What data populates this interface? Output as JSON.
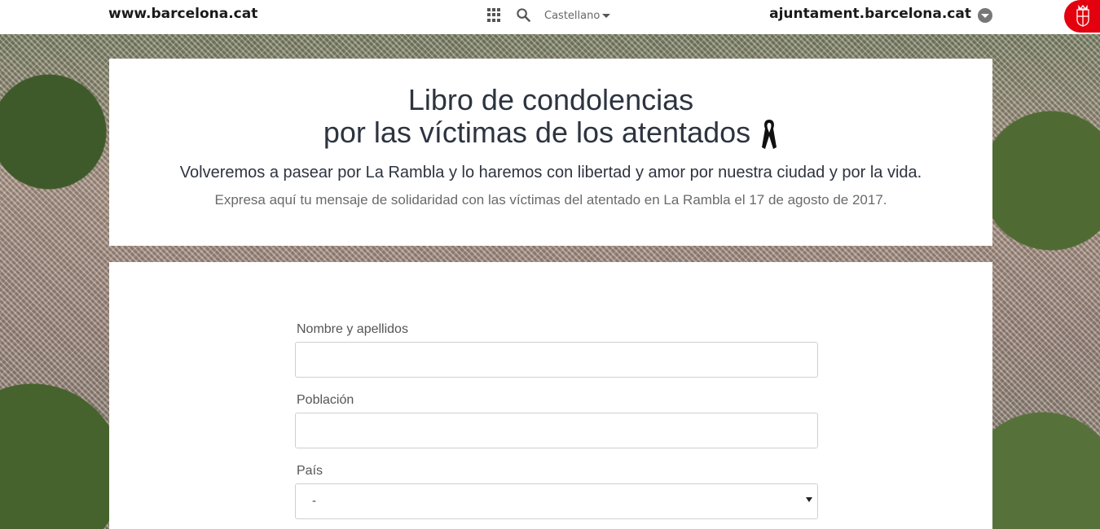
{
  "topbar": {
    "site_link": "www.barcelona.cat",
    "language": "Castellano",
    "ajuntament_link": "ajuntament.barcelona.cat"
  },
  "icons": {
    "apps": "grid-icon",
    "search": "search-icon",
    "ribbon": "mourning-ribbon-icon",
    "logo": "barcelona-coat-of-arms-icon"
  },
  "colors": {
    "brand_red": "#e3000f",
    "title_text": "#2d3440",
    "muted_text": "#6a6a6a"
  },
  "header": {
    "title_line1": "Libro de condolencias",
    "title_line2": "por las víctimas de los atentados",
    "subtitle": "Volveremos a pasear por La Rambla y lo haremos con libertad y amor por nuestra ciudad y por la vida.",
    "description": "Expresa aquí tu mensaje de solidaridad con las víctimas del atentado en La Rambla el 17 de agosto de 2017."
  },
  "form": {
    "name_label": "Nombre y apellidos",
    "name_value": "",
    "population_label": "Población",
    "population_value": "",
    "country_label": "País",
    "country_selected": "-"
  }
}
